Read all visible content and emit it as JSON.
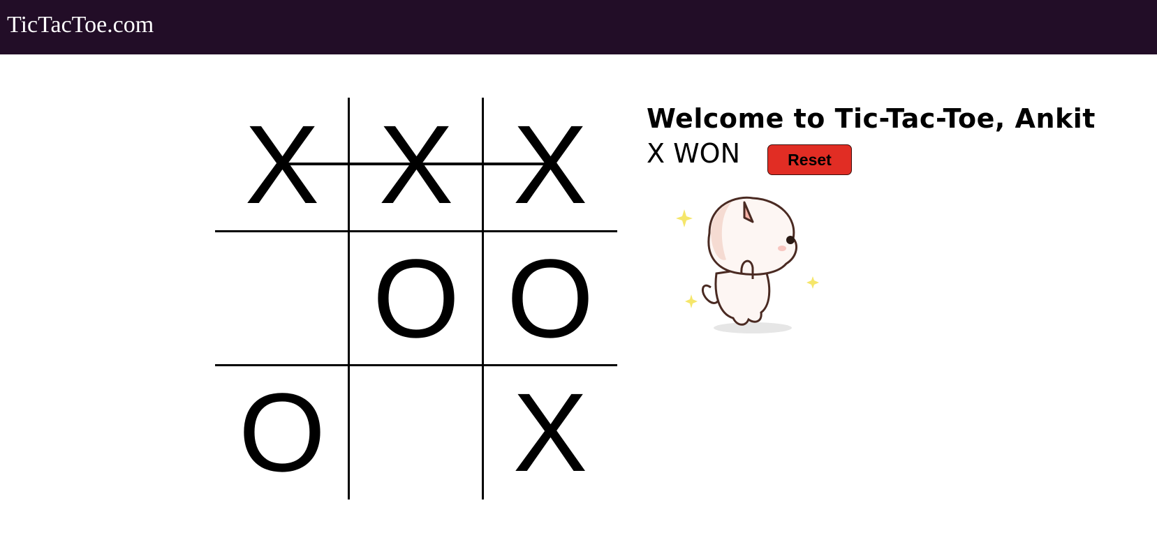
{
  "navbar": {
    "brand": "TicTacToe.com",
    "background": "#220d27"
  },
  "board": {
    "cells": [
      "X",
      "X",
      "X",
      "",
      "O",
      "O",
      "O",
      "",
      "X"
    ],
    "winning_line": "top-row"
  },
  "panel": {
    "welcome": "Welcome to Tic-Tac-Toe, Ankit",
    "status": "X WON",
    "reset_label": "Reset",
    "reset_color": "#e12d24"
  },
  "mascot": {
    "icon": "cat-mascot-icon"
  }
}
